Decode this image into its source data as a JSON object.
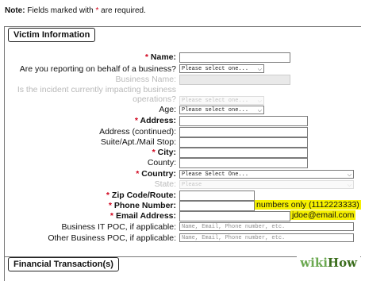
{
  "note": {
    "prefix": "Note:",
    "text": " Fields marked with ",
    "star": "*",
    "suffix": " are required."
  },
  "section_title": "Victim Information",
  "fields": {
    "name": {
      "label": "Name:"
    },
    "behalf": {
      "label": "Are you reporting on behalf of a business?",
      "value": "Please select one..."
    },
    "business_name": {
      "label": "Business Name:"
    },
    "impacting": {
      "label": "Is the incident currently impacting business",
      "label2": "operations?",
      "value": "Please select one..."
    },
    "age": {
      "label": "Age:",
      "value": "Please select one..."
    },
    "address": {
      "label": "Address:"
    },
    "address2": {
      "label": "Address (continued):"
    },
    "suite": {
      "label": "Suite/Apt./Mail Stop:"
    },
    "city": {
      "label": "City:"
    },
    "county": {
      "label": "County:"
    },
    "country": {
      "label": "Country:",
      "value": "Please Select One..."
    },
    "state": {
      "label": "State:",
      "value": "Please"
    },
    "zip": {
      "label": "Zip Code/Route:"
    },
    "phone": {
      "label": "Phone Number:",
      "hint": "numbers only (1112223333)"
    },
    "email": {
      "label": "Email Address:",
      "hint": "jdoe@email.com"
    },
    "it_poc": {
      "label": "Business IT POC, if applicable:",
      "placeholder": "Name, Email, Phone number, etc."
    },
    "other_poc": {
      "label": "Other Business POC, if applicable:",
      "placeholder": "Name, Email, Phone number, etc."
    }
  },
  "star": "*",
  "financial_title": "Financial Transaction(s)",
  "watermark": {
    "wiki": "wiki",
    "how": "How"
  }
}
